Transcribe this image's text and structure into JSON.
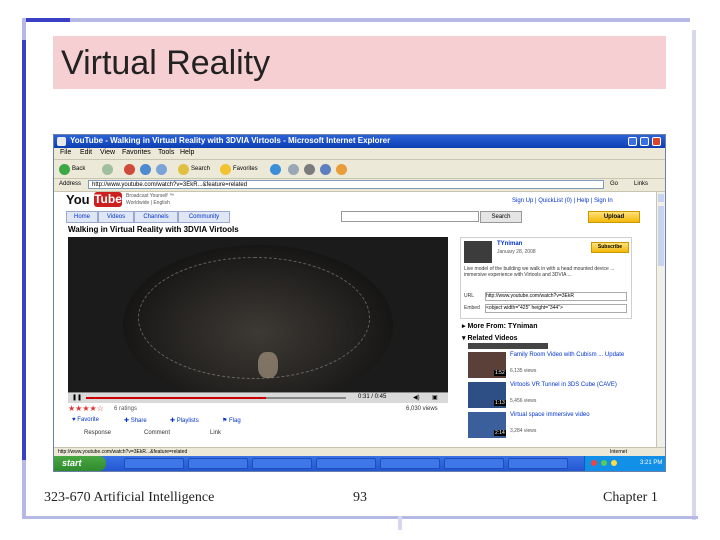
{
  "slide": {
    "title": "Virtual Reality",
    "footer_left": "323-670 Artificial Intelligence",
    "page_number": "93",
    "footer_right": "Chapter 1",
    "colors": {
      "title_band": "#f6cfd3",
      "accent_bar": "#3a3fc4",
      "light_bar": "#b6b8e6"
    }
  },
  "window": {
    "title": "YouTube - Walking in Virtual Reality with 3DVIA Virtools - Microsoft Internet Explorer",
    "menu": [
      "File",
      "Edit",
      "View",
      "Favorites",
      "Tools",
      "Help"
    ],
    "toolbar": {
      "back": "Back",
      "search": "Search",
      "favorites": "Favorites"
    },
    "address_label": "Address",
    "address": "http://www.youtube.com/watch?v=3EkR...&feature=related",
    "go_label": "Go",
    "links_label": "Links"
  },
  "youtube": {
    "logo_you": "You",
    "logo_tube": "Tube",
    "tagline": "Broadcast Yourself ™",
    "lang": "Worldwide | English",
    "top_links": "Sign Up  |  QuickList (0)  |  Help  |  Sign In",
    "nav": [
      "Home",
      "Videos",
      "Channels",
      "Community"
    ],
    "search_button": "Search",
    "upload_button": "Upload",
    "video_title": "Walking in Virtual Reality with 3DVIA Virtools",
    "time": "0:31 / 0:45",
    "stars": "★★★★☆",
    "ratings": "6 ratings",
    "views": "6,030 views",
    "actions": [
      "Favorite",
      "Share",
      "Playlists",
      "Flag"
    ],
    "sub_actions": [
      "Response",
      "Comment",
      "Link"
    ],
    "channel": {
      "name": "TYniman",
      "meta": "January 28, 2008",
      "subscribe": "Subscribe",
      "desc": "Live model of the building we walk in with a head mounted device ... immersive experience with Virtools and 3DVIA ...",
      "url_label": "URL",
      "url": "http://www.youtube.com/watch?v=3EkR",
      "embed_label": "Embed",
      "embed": "<object width=\"425\" height=\"344\">"
    },
    "more_from": "More From: TYniman",
    "related_head": "Related Videos",
    "related": [
      {
        "title": "Family Room Video with Cubism ... Update",
        "meta": "6,135 views",
        "dur": "1:52"
      },
      {
        "title": "Virtools VR Tunnel in 3DS Cube (CAVE)",
        "meta": "5,456 views",
        "dur": "1:13"
      },
      {
        "title": "Virtual space immersive video",
        "meta": "3,284 views",
        "dur": "2:14"
      }
    ]
  },
  "status": {
    "text": "http://www.youtube.com/watch?v=3EkR...&feature=related",
    "zone": "Internet"
  },
  "taskbar": {
    "start": "start",
    "clock": "3:21 PM"
  }
}
